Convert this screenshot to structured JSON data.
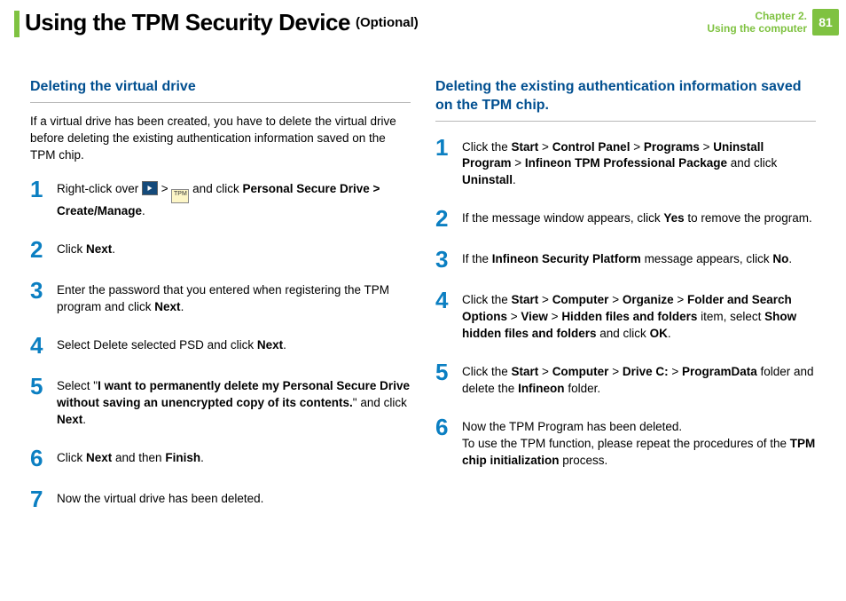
{
  "header": {
    "title": "Using the TPM Security Device",
    "optional": "(Optional)",
    "chapter_line1": "Chapter 2.",
    "chapter_line2": "Using the computer",
    "page_number": "81"
  },
  "left": {
    "subhead": "Deleting the virtual drive",
    "intro": "If a virtual drive has been created, you have to delete the virtual drive before deleting the existing authentication information saved on the TPM chip.",
    "steps": [
      {
        "n": "1",
        "html": "Right-click over <span class='icon-box' data-name='system-tray-icon' data-interactable='false'></span> > <span class='icon-tpm' data-name='tpm-tray-icon' data-interactable='false'>TPM</span> and click <b>Personal Secure Drive > Create/Manage</b>."
      },
      {
        "n": "2",
        "html": "Click <b>Next</b>."
      },
      {
        "n": "3",
        "html": "Enter the password that you entered when registering the TPM program and click <b>Next</b>."
      },
      {
        "n": "4",
        "html": "Select Delete selected PSD and click <b>Next</b>."
      },
      {
        "n": "5",
        "html": "Select \"<b>I want to permanently delete my Personal Secure Drive without saving an unencrypted copy of its contents.</b>\" and click <b>Next</b>."
      },
      {
        "n": "6",
        "html": "Click <b>Next</b> and then <b>Finish</b>."
      },
      {
        "n": "7",
        "html": "Now the virtual drive has been deleted."
      }
    ]
  },
  "right": {
    "subhead": "Deleting the existing authentication information saved on the TPM chip.",
    "steps": [
      {
        "n": "1",
        "html": "Click the <b>Start</b> > <b>Control Panel</b> > <b>Programs</b> > <b>Uninstall Program</b> > <b>Infineon TPM Professional Package</b> and click <b>Uninstall</b>."
      },
      {
        "n": "2",
        "html": "If the message window appears, click <b>Yes</b> to remove the program."
      },
      {
        "n": "3",
        "html": "If the <b>Infineon Security Platform</b> message appears, click <b>No</b>."
      },
      {
        "n": "4",
        "html": "Click the <b>Start</b> > <b>Computer</b> > <b>Organize</b> > <b>Folder and Search Options</b> > <b>View</b> > <b>Hidden files and folders</b> item, select <b>Show hidden files and folders</b> and click <b>OK</b>."
      },
      {
        "n": "5",
        "html": "Click the <b>Start</b> > <b>Computer</b> > <b>Drive C:</b> > <b>ProgramData</b> folder and delete the <b>Infineon</b> folder."
      },
      {
        "n": "6",
        "html": "Now the TPM Program has been deleted.<br>To use the TPM function, please repeat the procedures of the <b>TPM chip initialization</b> process."
      }
    ]
  }
}
